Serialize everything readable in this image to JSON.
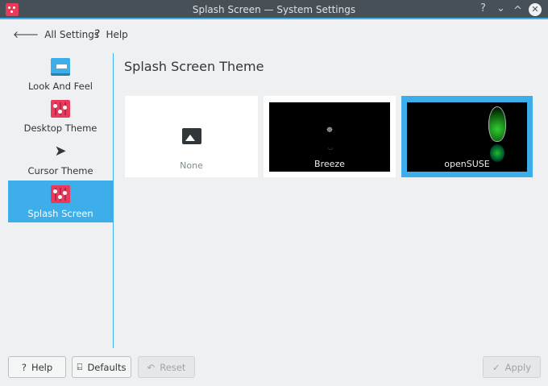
{
  "window": {
    "title": "Splash Screen — System Settings",
    "help": "?",
    "minimize": "⌄",
    "maximize": "^",
    "close": "✕"
  },
  "toolbar": {
    "all_settings": "All Settings",
    "help": "Help"
  },
  "sidebar": {
    "items": [
      {
        "label": "Look And Feel"
      },
      {
        "label": "Desktop Theme"
      },
      {
        "label": "Cursor Theme"
      },
      {
        "label": "Splash Screen",
        "selected": true
      }
    ]
  },
  "main": {
    "title": "Splash Screen Theme",
    "themes": [
      {
        "label": "None"
      },
      {
        "label": "Breeze"
      },
      {
        "label": "openSUSE",
        "selected": true
      }
    ]
  },
  "footer": {
    "help": "Help",
    "defaults": "Defaults",
    "reset": "Reset",
    "apply": "Apply"
  },
  "colors": {
    "accent": "#3daee9",
    "titlebar": "#475057",
    "icon_red": "#e93a5b"
  }
}
